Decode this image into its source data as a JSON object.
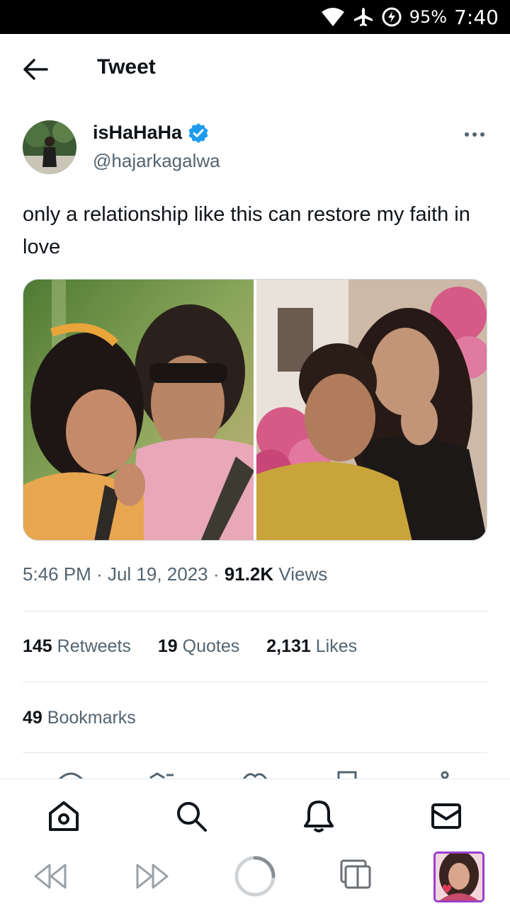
{
  "status_bar": {
    "battery": "95%",
    "time": "7:40"
  },
  "header": {
    "title": "Tweet"
  },
  "tweet": {
    "author_name": "isHaHaHa",
    "author_handle": "@hajarkagalwa",
    "verified": true,
    "text": "only a relationship like this can restore my faith in love",
    "time": "5:46 PM",
    "date": "Jul 19, 2023",
    "views_count": "91.2K",
    "views_label": "Views",
    "separator": "·"
  },
  "stats": {
    "retweets_count": "145",
    "retweets_label": "Retweets",
    "quotes_count": "19",
    "quotes_label": "Quotes",
    "likes_count": "2,131",
    "likes_label": "Likes",
    "bookmarks_count": "49",
    "bookmarks_label": "Bookmarks"
  },
  "bottom_nav": {
    "items": [
      "home-icon",
      "search-icon",
      "notifications-icon",
      "messages-icon"
    ]
  },
  "browser_bar": {
    "items": [
      "rewind-icon",
      "fast-forward-icon",
      "loading-ring-icon",
      "tabs-icon",
      "profile-thumbnail"
    ]
  },
  "colors": {
    "verified": "#1d9bf0",
    "secondary_text": "#536471",
    "primary_text": "#0f1419"
  }
}
